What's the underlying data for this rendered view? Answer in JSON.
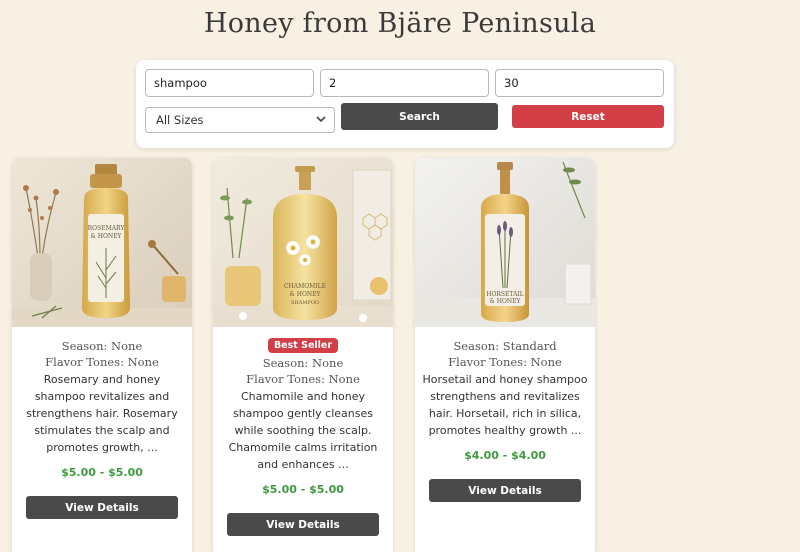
{
  "page": {
    "title": "Honey from Bjäre Peninsula"
  },
  "search": {
    "keyword_value": "shampoo",
    "min_value": "2",
    "max_value": "30",
    "size_selected": "All Sizes",
    "search_label": "Search",
    "reset_label": "Reset"
  },
  "products": [
    {
      "name": "Rosemary & Honey",
      "badge": "",
      "season": "Season: None",
      "flavor": "Flavor Tones: None",
      "description": "Rosemary and honey shampoo revitalizes and strengthens hair. Rosemary stimulates the scalp and promotes growth, ...",
      "price": "$5.00 - $5.00",
      "button_label": "View Details"
    },
    {
      "name": "Chamomile & Honey Shampoo",
      "badge": "Best Seller",
      "season": "Season: None",
      "flavor": "Flavor Tones: None",
      "description": "Chamomile and honey shampoo gently cleanses while soothing the scalp. Chamomile calms irritation and enhances ...",
      "price": "$5.00 - $5.00",
      "button_label": "View Details"
    },
    {
      "name": "Horsetail & Honey",
      "badge": "",
      "season": "Season: Standard",
      "flavor": "Flavor Tones: None",
      "description": "Horsetail and honey shampoo strengthens and revitalizes hair. Horsetail, rich in silica, promotes healthy growth ...",
      "price": "$4.00 - $4.00",
      "button_label": "View Details"
    }
  ],
  "colors": {
    "background": "#f8f0e3",
    "primary_button": "#4a4a4a",
    "reset_button": "#d23f47",
    "price_green": "#3f9a3f",
    "badge_red": "#d23f47"
  },
  "icons": {
    "select_arrow": "chevron-down-icon"
  }
}
